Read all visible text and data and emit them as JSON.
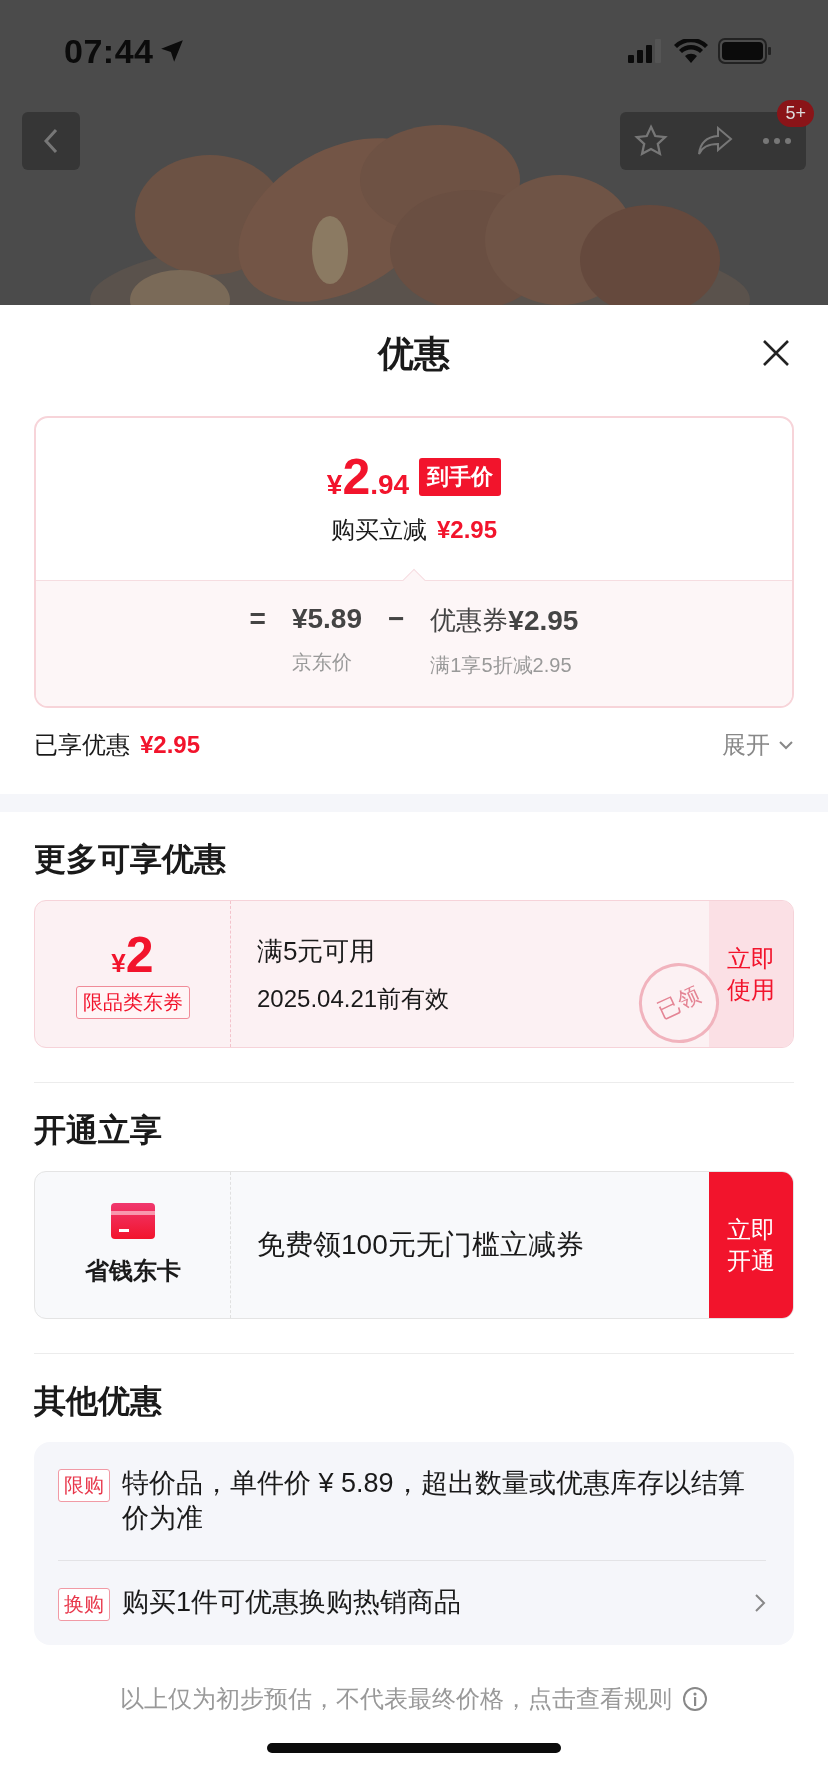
{
  "status_bar": {
    "time": "07:44"
  },
  "nav": {
    "badge": "5+"
  },
  "sheet": {
    "title": "优惠"
  },
  "price_card": {
    "currency": "¥",
    "price_int": "2",
    "price_dec": ".94",
    "tag": "到手价",
    "instant_label": "购买立减",
    "instant_amount": "¥2.95",
    "equals": "=",
    "base_price": "¥5.89",
    "base_label": "京东价",
    "minus": "−",
    "coupon_label": "优惠券",
    "coupon_amount": "¥2.95",
    "coupon_rule": "满1享5折减2.95"
  },
  "enjoyed": {
    "label": "已享优惠",
    "amount": "¥2.95",
    "toggle": "展开",
    "expanded": false
  },
  "more_offers": {
    "title": "更多可享优惠",
    "coupons": [
      {
        "currency": "¥",
        "amount": "2",
        "scope": "限品类东券",
        "condition": "满5元可用",
        "validity": "2025.04.21前有效",
        "stamp": "已领",
        "action": "立即使用"
      }
    ]
  },
  "membership": {
    "title": "开通立享",
    "name": "省钱东卡",
    "offer": "免费领100元无门槛立减券",
    "action": "立即开通"
  },
  "other_offers": {
    "title": "其他优惠",
    "items": [
      {
        "tag": "限购",
        "text": "特价品，单件价 ¥ 5.89，超出数量或优惠库存以结算价为准",
        "has_arrow": false
      },
      {
        "tag": "换购",
        "text": "购买1件可优惠换购热销商品",
        "has_arrow": true
      }
    ]
  },
  "footer": {
    "note": "以上仅为初步预估，不代表最终价格，点击查看规则"
  }
}
